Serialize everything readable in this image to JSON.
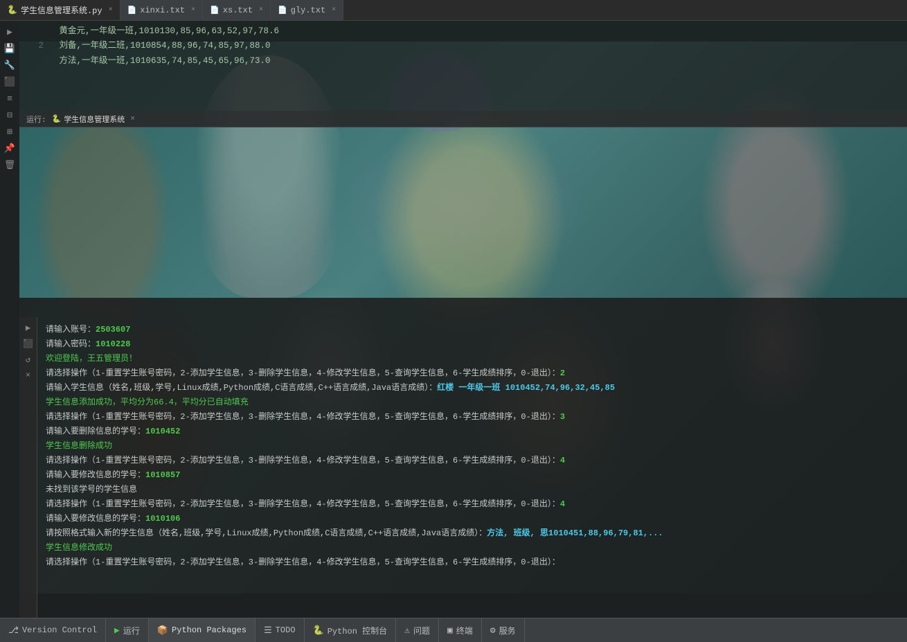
{
  "tabs": [
    {
      "id": "tab1",
      "label": "学生信息管理系统.py",
      "icon": "🐍",
      "active": false,
      "closable": true
    },
    {
      "id": "tab2",
      "label": "xinxi.txt",
      "icon": "📄",
      "active": false,
      "closable": true
    },
    {
      "id": "tab3",
      "label": "xs.txt",
      "icon": "📄",
      "active": false,
      "closable": true
    },
    {
      "id": "tab4",
      "label": "gly.txt",
      "icon": "📄",
      "active": true,
      "closable": true
    }
  ],
  "code_lines": [
    {
      "number": "",
      "content": "黄金元,一年级一班,1010130,85,96,63,52,97,78.6"
    },
    {
      "number": "2",
      "content": "刘备,一年级二班,1010854,88,96,74,85,97,88.0"
    },
    {
      "number": "",
      "content": "方法,一年级一班,1010635,74,85,45,65,96,73.0"
    }
  ],
  "run_bar": {
    "label": "运行:",
    "title": "🐍 学生信息管理系统",
    "close": "×"
  },
  "console": {
    "title": "学生信息管理系统",
    "lines": [
      {
        "type": "normal",
        "text": "请输入账号：",
        "value": "2503607"
      },
      {
        "type": "normal",
        "text": "请输入密码：",
        "value": "1010228"
      },
      {
        "type": "green",
        "text": "欢迎登陆，王五管理员！"
      },
      {
        "type": "normal",
        "text": "请选择操作（1-重置学生账号密码，2-添加学生信息，3-删除学生信息，4-修改学生信息，5-查询学生信息，6-学生成绩排序，0-退出）：",
        "value": "2"
      },
      {
        "type": "normal",
        "text": "请输入学生信息（姓名,班级,学号,Linux成绩,Python成绩,C语言成绩,C++语言成绩,Java语言成绩）：",
        "value": "红楼 一年级一班 1010452,74,96,32,45,85"
      },
      {
        "type": "green",
        "text": "学生信息添加成功，平均分为66.4，平均分已自动填充"
      },
      {
        "type": "normal",
        "text": "请选择操作（1-重置学生账号密码，2-添加学生信息，3-删除学生信息，4-修改学生信息，5-查询学生信息，6-学生成绩排序，0-退出）：",
        "value": "3"
      },
      {
        "type": "normal",
        "text": "请输入要删除信息的学号：",
        "value": "1010452"
      },
      {
        "type": "green",
        "text": "学生信息删除成功"
      },
      {
        "type": "normal",
        "text": "请选择操作（1-重置学生账号密码，2-添加学生信息，3-删除学生信息，4-修改学生信息，5-查询学生信息，6-学生成绩排序，0-退出）：",
        "value": "4"
      },
      {
        "type": "normal",
        "text": "请输入要修改信息的学号：",
        "value": "1010857"
      },
      {
        "type": "normal",
        "text": "未找到该学号的学生信息"
      },
      {
        "type": "normal",
        "text": "请选择操作（1-重置学生账号密码，2-添加学生信息，3-删除学生信息，4-修改学生信息，5-查询学生信息，6-学生成绩排序，0-退出）：",
        "value": "4"
      },
      {
        "type": "normal",
        "text": "请输入要修改信息的学号：",
        "value": "1010106"
      },
      {
        "type": "normal",
        "text": "请按照格式输入新的学生信息（姓名,班级,学号,Linux成绩,Python成绩,C语言成绩,C++语言成绩,Java语言成绩）：",
        "value": "方法, 班级, 思1010451,88,96,79,81,..."
      },
      {
        "type": "green",
        "text": "学生信息修改成功"
      },
      {
        "type": "normal",
        "text": "请选择操作（1-重置学生账号密码，2-添加学生信息，3-删除学生信息，4-修改学生信息，5-查询学生信息，6-学生成绩排序，0-退出）："
      }
    ]
  },
  "sidebar_icons": [
    {
      "name": "play",
      "symbol": "▶",
      "active": false
    },
    {
      "name": "save",
      "symbol": "💾",
      "active": false
    },
    {
      "name": "wrench",
      "symbol": "🔧",
      "active": false
    },
    {
      "name": "stop-red",
      "symbol": "⬛",
      "active": true
    },
    {
      "name": "list",
      "symbol": "≡",
      "active": false
    },
    {
      "name": "panel",
      "symbol": "⊟",
      "active": false
    },
    {
      "name": "grid",
      "symbol": "⊞",
      "active": false
    },
    {
      "name": "pin",
      "symbol": "📌",
      "active": false
    },
    {
      "name": "trash",
      "symbol": "🗑",
      "active": false
    }
  ],
  "console_toolbar": [
    {
      "name": "play-console",
      "symbol": "▶"
    },
    {
      "name": "stop-console",
      "symbol": "⬛",
      "active": true
    },
    {
      "name": "refresh-console",
      "symbol": "↺"
    },
    {
      "name": "close-console",
      "symbol": "×"
    }
  ],
  "status_bar": {
    "items": [
      {
        "id": "version-control",
        "icon": "⎇",
        "label": "Version Control",
        "active": false
      },
      {
        "id": "run",
        "icon": "▶",
        "label": "运行",
        "active": false,
        "run": true
      },
      {
        "id": "python-packages",
        "icon": "📦",
        "label": "Python Packages",
        "active": true
      },
      {
        "id": "todo",
        "icon": "☰",
        "label": "TODO",
        "active": false
      },
      {
        "id": "python-console",
        "icon": "🐍",
        "label": "Python 控制台",
        "active": false
      },
      {
        "id": "issues",
        "icon": "⚠",
        "label": "问题",
        "active": false
      },
      {
        "id": "terminal",
        "icon": "▣",
        "label": "终端",
        "active": false
      },
      {
        "id": "services",
        "icon": "⚙",
        "label": "服务",
        "active": false
      }
    ]
  }
}
